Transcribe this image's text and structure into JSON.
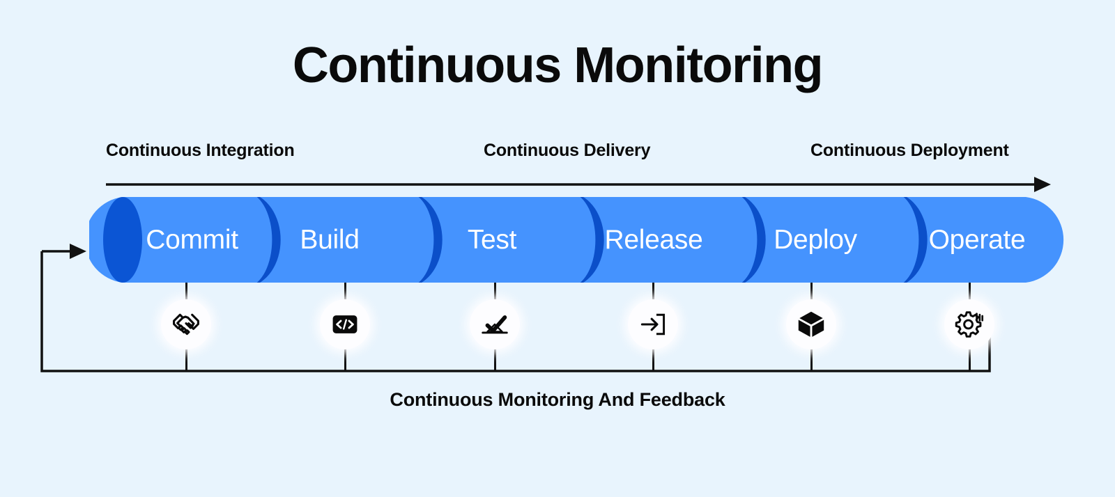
{
  "page": {
    "title": "Continuous Monitoring",
    "background_color": "#e8f4fd",
    "text_color": "#0a0a0a"
  },
  "phases": {
    "arrow_label": "left-to-right-flow-arrow",
    "items": [
      {
        "label": "Continuous Integration"
      },
      {
        "label": "Continuous Delivery"
      },
      {
        "label": "Continuous Deployment"
      }
    ]
  },
  "pipeline": {
    "body_color": "#4593fe",
    "cap_color": "#0b55d4",
    "separator_color": "#0b4fc9",
    "label_color": "#ffffff",
    "stages": [
      {
        "label": "Commit",
        "icon": "handshake-icon"
      },
      {
        "label": "Build",
        "icon": "code-brackets-icon"
      },
      {
        "label": "Test",
        "icon": "checkmark-tray-icon"
      },
      {
        "label": "Release",
        "icon": "arrow-into-bracket-icon"
      },
      {
        "label": "Deploy",
        "icon": "cube-box-icon"
      },
      {
        "label": "Operate",
        "icon": "gear-signal-icon"
      }
    ]
  },
  "feedback": {
    "caption": "Continuous Monitoring And Feedback",
    "loop_name": "feedback-loop-arrow",
    "line_color": "#111111"
  }
}
